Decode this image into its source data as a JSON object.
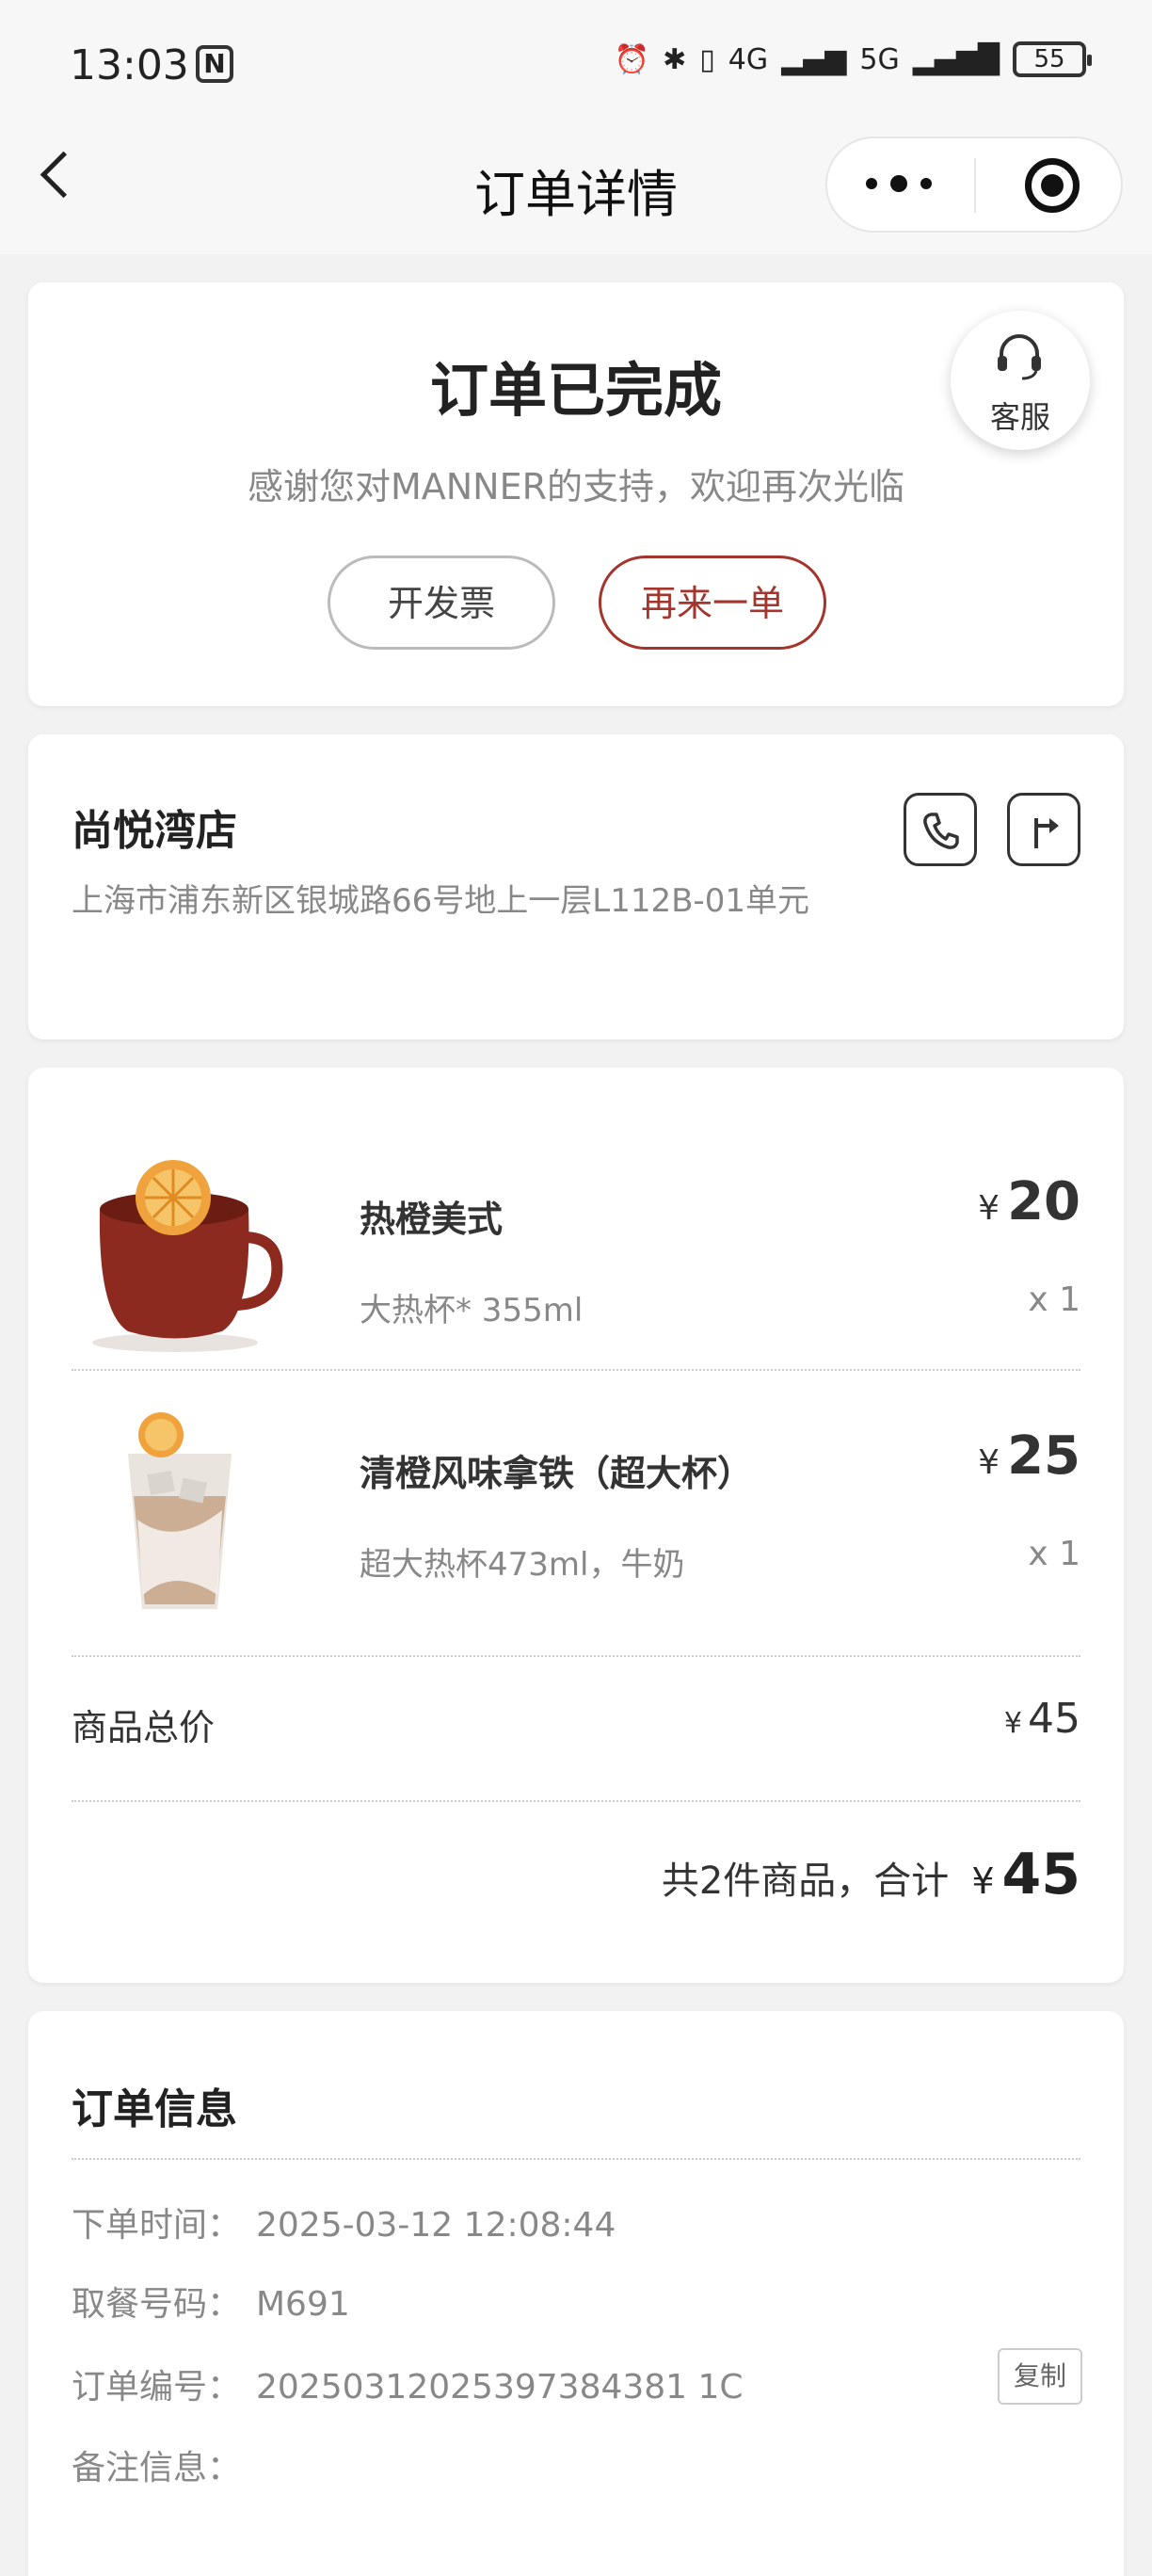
{
  "status_bar": {
    "time": "13:03",
    "nfc": "N",
    "network": [
      "4G",
      "5G"
    ],
    "battery": "55"
  },
  "nav": {
    "title": "订单详情"
  },
  "order_status": {
    "title": "订单已完成",
    "subtitle": "感谢您对MANNER的支持，欢迎再次光临",
    "invoice_button": "开发票",
    "reorder_button": "再来一单",
    "customer_service": "客服"
  },
  "store": {
    "name": "尚悦湾店",
    "address": "上海市浦东新区银城路66号地上一层L112B-01单元"
  },
  "items": [
    {
      "name": "热橙美式",
      "spec": "大热杯* 355ml",
      "currency": "¥",
      "price": "20",
      "qty": "x 1"
    },
    {
      "name": "清橙风味拿铁（超大杯）",
      "spec": "超大热杯473ml，牛奶",
      "currency": "¥",
      "price": "25",
      "qty": "x 1"
    }
  ],
  "summary": {
    "subtotal_label": "商品总价",
    "subtotal_currency": "¥",
    "subtotal_value": "45",
    "total_label": "共2件商品，合计",
    "total_currency": "¥",
    "total_value": "45"
  },
  "order_info": {
    "title": "订单信息",
    "rows": [
      {
        "label": "下单时间：",
        "value": "2025-03-12 12:08:44"
      },
      {
        "label": "取餐号码：",
        "value": "M691"
      },
      {
        "label": "订单编号：",
        "value": "20250312025397384381 1C"
      },
      {
        "label": "备注信息：",
        "value": ""
      }
    ],
    "copy_button": "复制"
  },
  "colors": {
    "accent": "#a3352c",
    "background": "#f2f2f2",
    "card": "#ffffff",
    "secondary_text": "#888888"
  }
}
